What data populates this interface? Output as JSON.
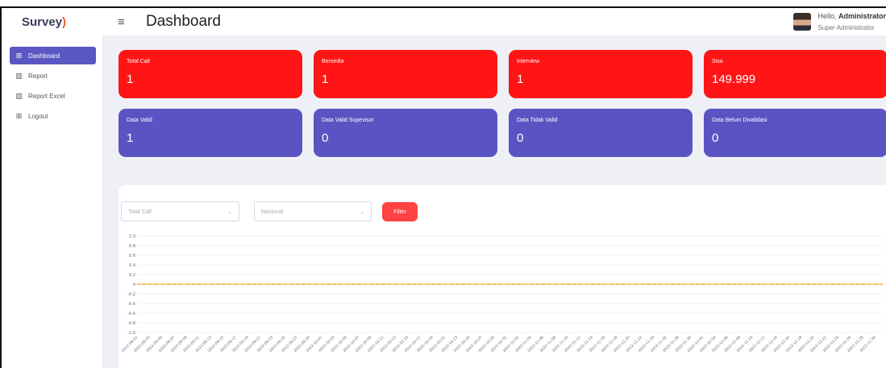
{
  "header": {
    "brand_main": "Survey",
    "brand_mark": ")",
    "page_title": "Dashboard",
    "menu_icon": "hamburger-icon",
    "user_greeting": "Hello,",
    "user_name": "Administrator",
    "user_role": "Super Administrator"
  },
  "sidebar": {
    "items": [
      {
        "label": "Dashboard",
        "icon": "grid-icon",
        "active": true
      },
      {
        "label": "Report",
        "icon": "table-icon",
        "active": false
      },
      {
        "label": "Report Excel",
        "icon": "table-icon",
        "active": false
      },
      {
        "label": "Logout",
        "icon": "grid-icon",
        "active": false
      }
    ]
  },
  "cards": [
    {
      "label": "Total Call",
      "value": "1",
      "color": "#ff1515"
    },
    {
      "label": "Bersedia",
      "value": "1",
      "color": "#ff1515"
    },
    {
      "label": "Interview",
      "value": "1",
      "color": "#ff1515"
    },
    {
      "label": "Sisa",
      "value": "149.999",
      "color": "#ff1515"
    },
    {
      "label": "Data Valid",
      "value": "1",
      "color": "#5a54c3"
    },
    {
      "label": "Data Valid Supevisor",
      "value": "0",
      "color": "#5a54c3"
    },
    {
      "label": "Data Tidak Valid",
      "value": "0",
      "color": "#5a54c3"
    },
    {
      "label": "Data Belum Divalidasi",
      "value": "0",
      "color": "#5a54c3"
    }
  ],
  "filters": {
    "metric_select": "Total Call",
    "region_select": "Nasional",
    "filter_button": "Filter"
  },
  "chart_data": {
    "type": "line",
    "ylim": [
      -1.0,
      1.0
    ],
    "yticks": [
      "1.0",
      "0.8",
      "0.6",
      "0.4",
      "0.2",
      "0",
      "-0.2",
      "-0.4",
      "-0.6",
      "-0.8",
      "-1.0"
    ],
    "x_start": "2022-09-01",
    "x_end": "2022-12-31",
    "x_label_every_days": 2,
    "series": [
      {
        "values_constant": 0,
        "color": "#f0b43c"
      }
    ],
    "grid": true
  }
}
